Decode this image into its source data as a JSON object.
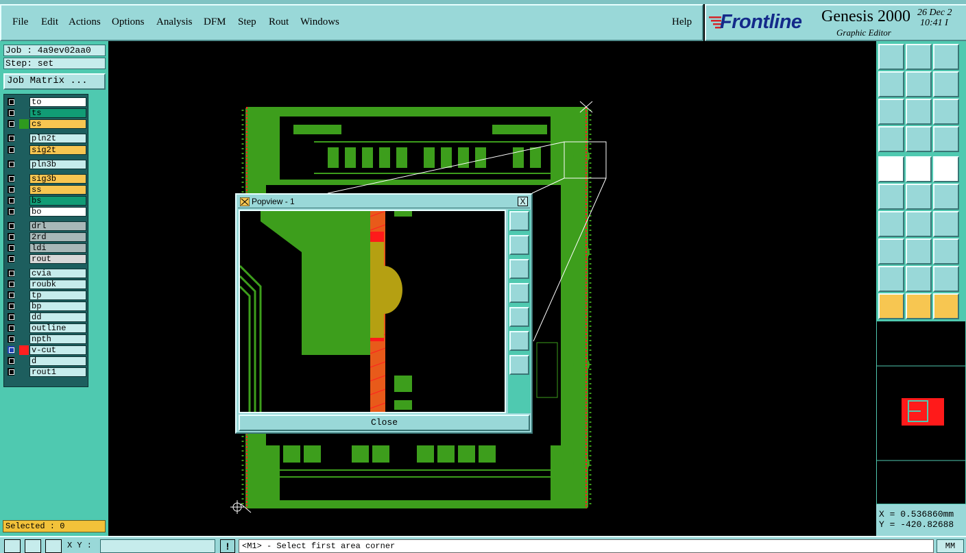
{
  "menubar": {
    "items": [
      "File",
      "Edit",
      "Actions",
      "Options",
      "Analysis",
      "DFM",
      "Step",
      "Rout",
      "Windows"
    ],
    "help": "Help"
  },
  "brand": {
    "logo": "Frontline",
    "title": "Genesis 2000",
    "subtitle": "Graphic Editor",
    "date": "26 Dec 2",
    "time": "10:41 I"
  },
  "job": {
    "label": "Job : 4a9ev02aa0",
    "step": "Step: set",
    "matrix_button": "Job Matrix ..."
  },
  "layers": [
    {
      "name": "to",
      "color": "#ffffff",
      "swatch": ""
    },
    {
      "name": "ts",
      "color": "#119c75",
      "swatch": ""
    },
    {
      "name": "cs",
      "color": "#f7c651",
      "swatch": "#2e9a1e"
    },
    {
      "name": "pln2t",
      "color": "#c6ecec",
      "swatch": ""
    },
    {
      "name": "sig2t",
      "color": "#f7c651",
      "swatch": ""
    },
    {
      "name": "pln3b",
      "color": "#c6ecec",
      "swatch": ""
    },
    {
      "name": "sig3b",
      "color": "#f7c651",
      "swatch": ""
    },
    {
      "name": "ss",
      "color": "#f7c651",
      "swatch": ""
    },
    {
      "name": "bs",
      "color": "#119c75",
      "swatch": ""
    },
    {
      "name": "bo",
      "color": "#ffffff",
      "swatch": ""
    },
    {
      "name": "drl",
      "color": "#a8b8b8",
      "swatch": ""
    },
    {
      "name": "2rd",
      "color": "#a8b8b8",
      "swatch": ""
    },
    {
      "name": "ldi",
      "color": "#a8b8b8",
      "swatch": ""
    },
    {
      "name": "rout",
      "color": "#d8d8d8",
      "swatch": ""
    },
    {
      "name": "cvia",
      "color": "#c6ecec",
      "swatch": ""
    },
    {
      "name": "roubk",
      "color": "#c6ecec",
      "swatch": ""
    },
    {
      "name": "tp",
      "color": "#c6ecec",
      "swatch": ""
    },
    {
      "name": "bp",
      "color": "#c6ecec",
      "swatch": ""
    },
    {
      "name": "dd",
      "color": "#c6ecec",
      "swatch": ""
    },
    {
      "name": "outline",
      "color": "#c6ecec",
      "swatch": ""
    },
    {
      "name": "npth",
      "color": "#c6ecec",
      "swatch": ""
    },
    {
      "name": "v-cut",
      "color": "#c6ecec",
      "swatch": "#ff2020",
      "active": true
    },
    {
      "name": "d",
      "color": "#c6ecec",
      "swatch": ""
    },
    {
      "name": "rout1",
      "color": "#c6ecec",
      "swatch": ""
    }
  ],
  "selected": "Selected : 0",
  "popview": {
    "title": "Popview - 1",
    "close_label": "Close",
    "close_x": "X"
  },
  "coords": {
    "x": "X = 0.536860mm",
    "y": "Y = -420.82688"
  },
  "statusbar": {
    "xy_label": "X Y :",
    "warn": "!",
    "message": "<M1> - Select first area corner",
    "units": "MM"
  },
  "colors": {
    "board_green": "#3d9e1c",
    "panel_teal": "#99d8d8",
    "accent_red": "#ff2020"
  }
}
